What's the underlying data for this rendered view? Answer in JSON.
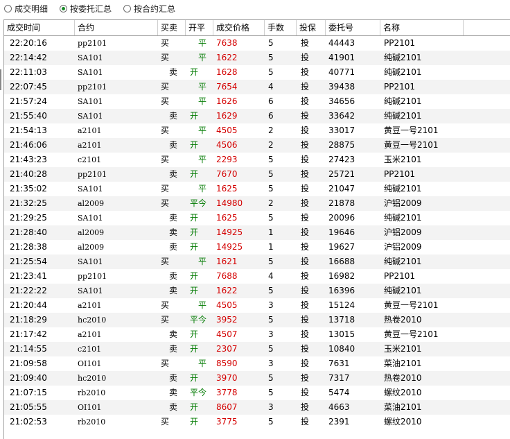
{
  "radios": [
    {
      "label": "成交明细",
      "checked": false
    },
    {
      "label": "按委托汇总",
      "checked": true
    },
    {
      "label": "按合约汇总",
      "checked": false
    }
  ],
  "columns": [
    "成交时间",
    "合约",
    "买卖",
    "开平",
    "成交价格",
    "手数",
    "投保",
    "委托号",
    "名称"
  ],
  "colors": {
    "price": "#d40000",
    "offset": "#007a00"
  },
  "rows": [
    {
      "time": "22:20:16",
      "contract": "pp2101",
      "side": "买",
      "offset": "平",
      "price": "7638",
      "qty": "5",
      "hedge": "投",
      "order": "44443",
      "name": "PP2101"
    },
    {
      "time": "22:14:42",
      "contract": "SA101",
      "side": "买",
      "offset": "平",
      "price": "1622",
      "qty": "5",
      "hedge": "投",
      "order": "41901",
      "name": "纯碱2101"
    },
    {
      "time": "22:11:03",
      "contract": "SA101",
      "side": "卖",
      "offset": "开",
      "price": "1628",
      "qty": "5",
      "hedge": "投",
      "order": "40771",
      "name": "纯碱2101"
    },
    {
      "time": "22:07:45",
      "contract": "pp2101",
      "side": "买",
      "offset": "平",
      "price": "7654",
      "qty": "4",
      "hedge": "投",
      "order": "39438",
      "name": "PP2101"
    },
    {
      "time": "21:57:24",
      "contract": "SA101",
      "side": "买",
      "offset": "平",
      "price": "1626",
      "qty": "6",
      "hedge": "投",
      "order": "34656",
      "name": "纯碱2101"
    },
    {
      "time": "21:55:40",
      "contract": "SA101",
      "side": "卖",
      "offset": "开",
      "price": "1629",
      "qty": "6",
      "hedge": "投",
      "order": "33642",
      "name": "纯碱2101"
    },
    {
      "time": "21:54:13",
      "contract": "a2101",
      "side": "买",
      "offset": "平",
      "price": "4505",
      "qty": "2",
      "hedge": "投",
      "order": "33017",
      "name": "黄豆一号2101"
    },
    {
      "time": "21:46:06",
      "contract": "a2101",
      "side": "卖",
      "offset": "开",
      "price": "4506",
      "qty": "2",
      "hedge": "投",
      "order": "28875",
      "name": "黄豆一号2101"
    },
    {
      "time": "21:43:23",
      "contract": "c2101",
      "side": "买",
      "offset": "平",
      "price": "2293",
      "qty": "5",
      "hedge": "投",
      "order": "27423",
      "name": "玉米2101"
    },
    {
      "time": "21:40:28",
      "contract": "pp2101",
      "side": "卖",
      "offset": "开",
      "price": "7670",
      "qty": "5",
      "hedge": "投",
      "order": "25721",
      "name": "PP2101"
    },
    {
      "time": "21:35:02",
      "contract": "SA101",
      "side": "买",
      "offset": "平",
      "price": "1625",
      "qty": "5",
      "hedge": "投",
      "order": "21047",
      "name": "纯碱2101"
    },
    {
      "time": "21:32:25",
      "contract": "al2009",
      "side": "买",
      "offset": "平今",
      "price": "14980",
      "qty": "2",
      "hedge": "投",
      "order": "21878",
      "name": "沪铝2009"
    },
    {
      "time": "21:29:25",
      "contract": "SA101",
      "side": "卖",
      "offset": "开",
      "price": "1625",
      "qty": "5",
      "hedge": "投",
      "order": "20096",
      "name": "纯碱2101"
    },
    {
      "time": "21:28:40",
      "contract": "al2009",
      "side": "卖",
      "offset": "开",
      "price": "14925",
      "qty": "1",
      "hedge": "投",
      "order": "19646",
      "name": "沪铝2009"
    },
    {
      "time": "21:28:38",
      "contract": "al2009",
      "side": "卖",
      "offset": "开",
      "price": "14925",
      "qty": "1",
      "hedge": "投",
      "order": "19627",
      "name": "沪铝2009"
    },
    {
      "time": "21:25:54",
      "contract": "SA101",
      "side": "买",
      "offset": "平",
      "price": "1621",
      "qty": "5",
      "hedge": "投",
      "order": "16688",
      "name": "纯碱2101"
    },
    {
      "time": "21:23:41",
      "contract": "pp2101",
      "side": "卖",
      "offset": "开",
      "price": "7688",
      "qty": "4",
      "hedge": "投",
      "order": "16982",
      "name": "PP2101"
    },
    {
      "time": "21:22:22",
      "contract": "SA101",
      "side": "卖",
      "offset": "开",
      "price": "1622",
      "qty": "5",
      "hedge": "投",
      "order": "16396",
      "name": "纯碱2101"
    },
    {
      "time": "21:20:44",
      "contract": "a2101",
      "side": "买",
      "offset": "平",
      "price": "4505",
      "qty": "3",
      "hedge": "投",
      "order": "15124",
      "name": "黄豆一号2101"
    },
    {
      "time": "21:18:29",
      "contract": "hc2010",
      "side": "买",
      "offset": "平今",
      "price": "3952",
      "qty": "5",
      "hedge": "投",
      "order": "13718",
      "name": "热卷2010"
    },
    {
      "time": "21:17:42",
      "contract": "a2101",
      "side": "卖",
      "offset": "开",
      "price": "4507",
      "qty": "3",
      "hedge": "投",
      "order": "13015",
      "name": "黄豆一号2101"
    },
    {
      "time": "21:14:55",
      "contract": "c2101",
      "side": "卖",
      "offset": "开",
      "price": "2307",
      "qty": "5",
      "hedge": "投",
      "order": "10840",
      "name": "玉米2101"
    },
    {
      "time": "21:09:58",
      "contract": "OI101",
      "side": "买",
      "offset": "平",
      "price": "8590",
      "qty": "3",
      "hedge": "投",
      "order": "7631",
      "name": "菜油2101"
    },
    {
      "time": "21:09:40",
      "contract": "hc2010",
      "side": "卖",
      "offset": "开",
      "price": "3970",
      "qty": "5",
      "hedge": "投",
      "order": "7317",
      "name": "热卷2010"
    },
    {
      "time": "21:07:15",
      "contract": "rb2010",
      "side": "卖",
      "offset": "平今",
      "price": "3778",
      "qty": "5",
      "hedge": "投",
      "order": "5474",
      "name": "螺纹2010"
    },
    {
      "time": "21:05:55",
      "contract": "OI101",
      "side": "卖",
      "offset": "开",
      "price": "8607",
      "qty": "3",
      "hedge": "投",
      "order": "4663",
      "name": "菜油2101"
    },
    {
      "time": "21:02:53",
      "contract": "rb2010",
      "side": "买",
      "offset": "开",
      "price": "3775",
      "qty": "5",
      "hedge": "投",
      "order": "2391",
      "name": "螺纹2010"
    }
  ]
}
